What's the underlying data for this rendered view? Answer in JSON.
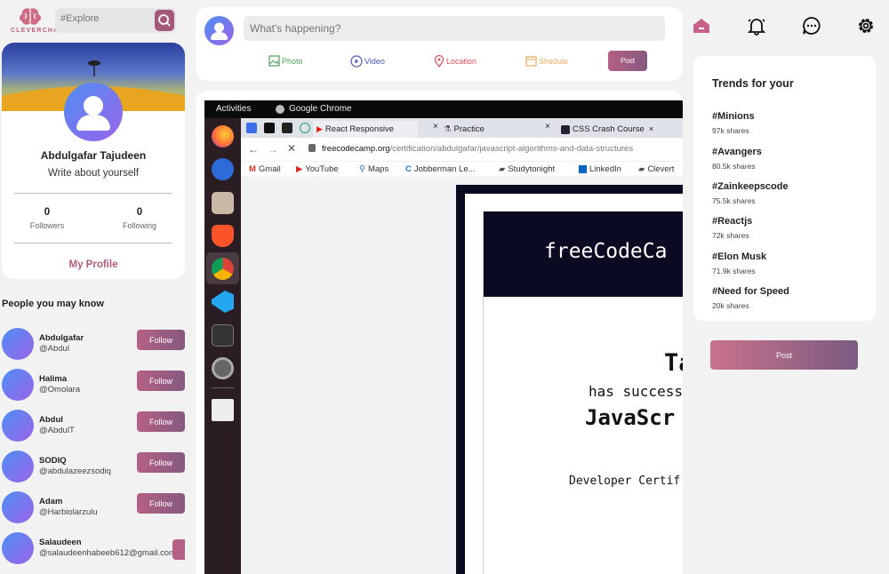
{
  "brand": {
    "name": "CLEVERCHAT"
  },
  "search": {
    "placeholder": "#Explore"
  },
  "profile": {
    "name": "Abdulgafar Tajudeen",
    "about": "Write about yourself",
    "followers_count": "0",
    "followers_label": "Followers",
    "following_count": "0",
    "following_label": "Following",
    "link": "My Profile"
  },
  "people": {
    "title": "People you may know",
    "follow_label": "Follow",
    "items": [
      {
        "name": "Abdulgafar",
        "handle": "@Abdul"
      },
      {
        "name": "Halima",
        "handle": "@Omolara"
      },
      {
        "name": "Abdul",
        "handle": "@AbdulT"
      },
      {
        "name": "SODIQ",
        "handle": "@abdulazeezsodiq"
      },
      {
        "name": "Adam",
        "handle": "@Harbiolarzulu"
      },
      {
        "name": "Salaudeen",
        "handle": "@salaudeenhabeeb612@gmail.com"
      }
    ]
  },
  "composer": {
    "placeholder": "What's happening?",
    "photo": "Photo",
    "video": "Video",
    "location": "Location",
    "schedule": "Shedule",
    "post": "Post"
  },
  "post_image": {
    "activities": "Activities",
    "app": "Google Chrome",
    "tabs": [
      "React Responsive",
      "Practice",
      "CSS Crash Course"
    ],
    "url_domain": "freecodecamp.org",
    "url_path": "/certification/abdulgafar/javascript-algorithms-and-data-structures",
    "bookmarks": [
      "Gmail",
      "YouTube",
      "Maps",
      "Jobberman Le...",
      "Studytonight",
      "LinkedIn",
      "Clevert"
    ],
    "cert_brand": "freeCodeCa",
    "cert_name": "Ta",
    "cert_line": "has success",
    "cert_course": "JavaScr",
    "cert_sub": "Developer Certif"
  },
  "trends": {
    "title": "Trends for your",
    "items": [
      {
        "tag": "#Minions",
        "shares": "97k shares"
      },
      {
        "tag": "#Avangers",
        "shares": "80.5k shares"
      },
      {
        "tag": "#Zainkeepscode",
        "shares": "75.5k shares"
      },
      {
        "tag": "#Reactjs",
        "shares": "72k shares"
      },
      {
        "tag": "#Elon Musk",
        "shares": "71.9k shares"
      },
      {
        "tag": "#Need for Speed",
        "shares": "20k shares"
      }
    ],
    "post_label": "Post"
  },
  "nav_icons": [
    "home-icon",
    "bell-icon",
    "chat-icon",
    "settings-icon"
  ],
  "colors": {
    "accent": "#b55a7e",
    "button_gradient_start": "#b56085",
    "button_gradient_end": "#86597f"
  }
}
